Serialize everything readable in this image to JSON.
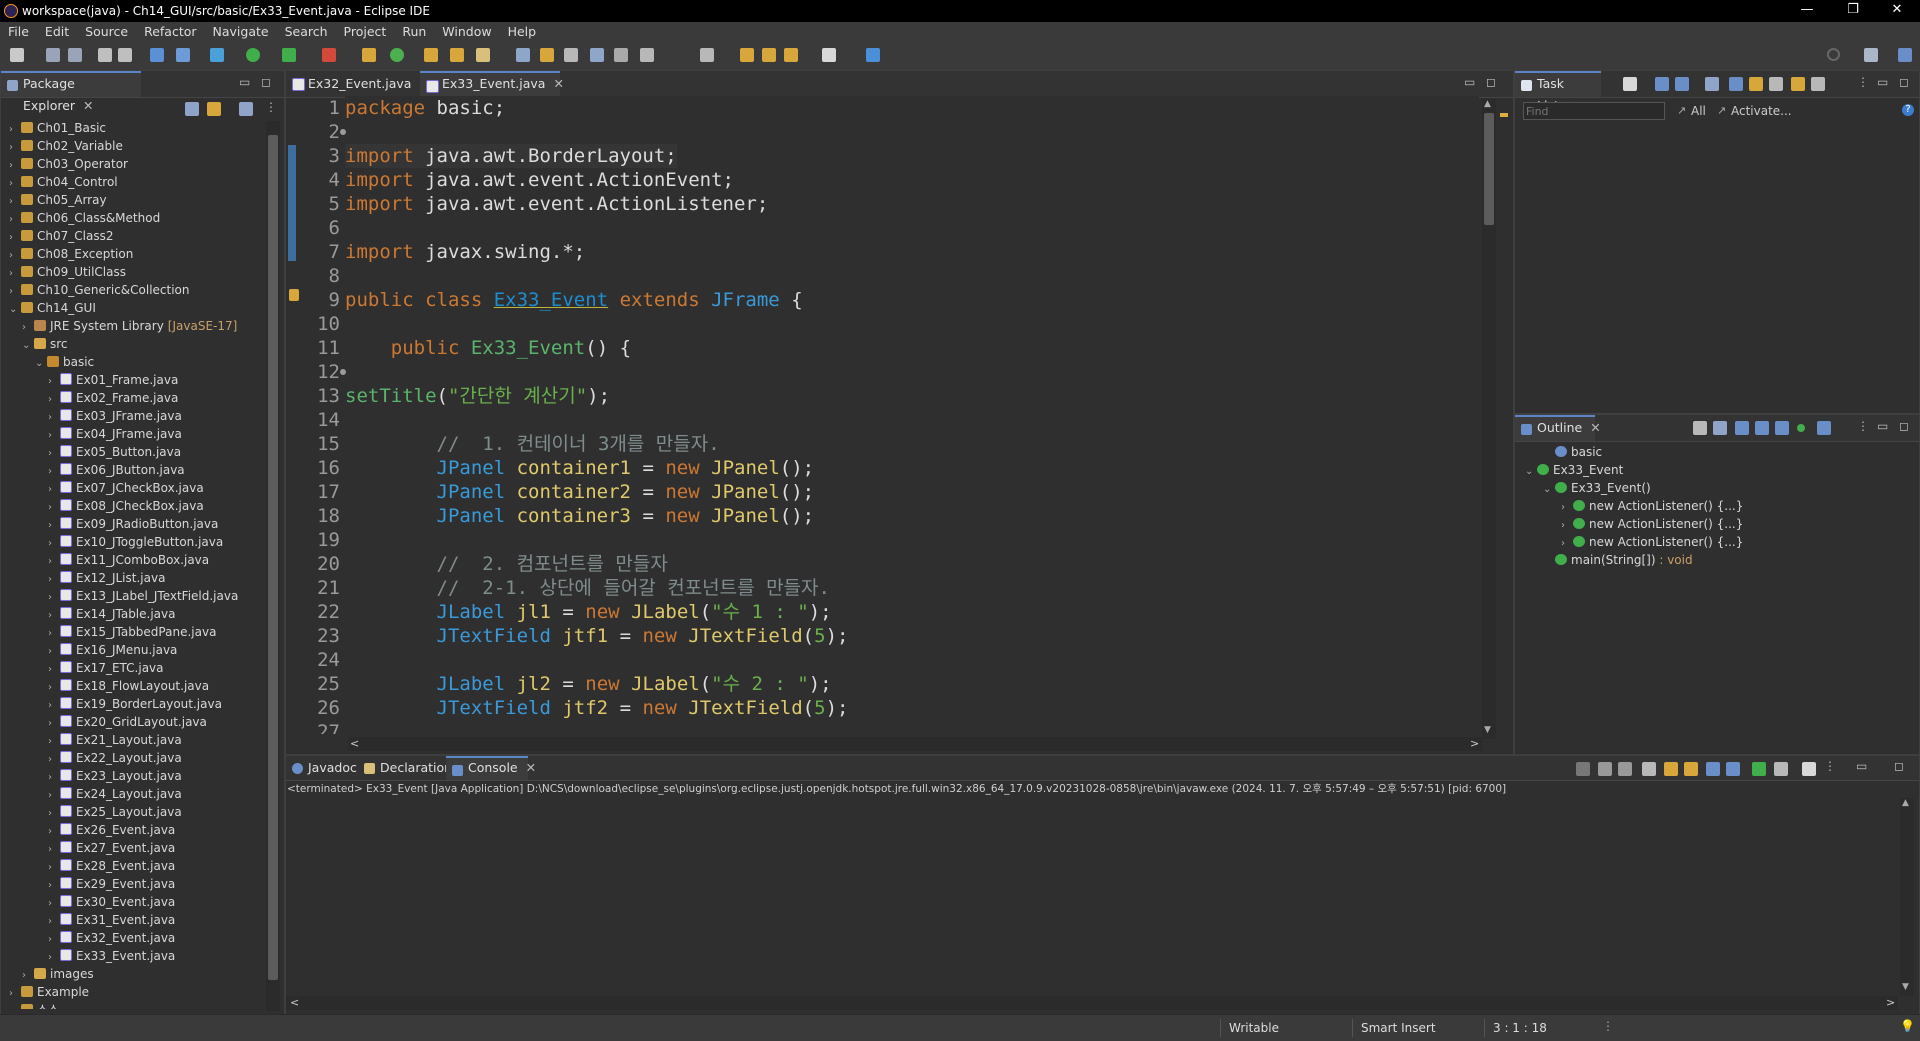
{
  "window": {
    "title": "workspace(java) - Ch14_GUI/src/basic/Ex33_Event.java - Eclipse IDE"
  },
  "menu": [
    "File",
    "Edit",
    "Source",
    "Refactor",
    "Navigate",
    "Search",
    "Project",
    "Run",
    "Window",
    "Help"
  ],
  "package_explorer": {
    "tab": "Package Explorer",
    "projects_top": [
      "Ch01_Basic",
      "Ch02_Variable",
      "Ch03_Operator",
      "Ch04_Control",
      "Ch05_Array",
      "Ch06_Class&Method",
      "Ch07_Class2",
      "Ch08_Exception",
      "Ch09_UtilClass",
      "Ch10_Generic&Collection",
      "Ch14_GUI"
    ],
    "jre": "JRE System Library",
    "jre_version": "[JavaSE-17]",
    "src": "src",
    "package": "basic",
    "files": [
      "Ex01_Frame.java",
      "Ex02_Frame.java",
      "Ex03_JFrame.java",
      "Ex04_JFrame.java",
      "Ex05_Button.java",
      "Ex06_JButton.java",
      "Ex07_JCheckBox.java",
      "Ex08_JCheckBox.java",
      "Ex09_JRadioButton.java",
      "Ex10_JToggleButton.java",
      "Ex11_JComboBox.java",
      "Ex12_JList.java",
      "Ex13_JLabel_JTextField.java",
      "Ex14_JTable.java",
      "Ex15_JTabbedPane.java",
      "Ex16_JMenu.java",
      "Ex17_ETC.java",
      "Ex18_FlowLayout.java",
      "Ex19_BorderLayout.java",
      "Ex20_GridLayout.java",
      "Ex21_Layout.java",
      "Ex22_Layout.java",
      "Ex23_Layout.java",
      "Ex24_Layout.java",
      "Ex25_Layout.java",
      "Ex26_Event.java",
      "Ex27_Event.java",
      "Ex28_Event.java",
      "Ex29_Event.java",
      "Ex30_Event.java",
      "Ex31_Event.java",
      "Ex32_Event.java",
      "Ex33_Event.java"
    ],
    "images": "images",
    "projects_bottom": [
      "Example",
      "소스"
    ]
  },
  "editor": {
    "tabs": [
      "Ex32_Event.java",
      "Ex33_Event.java"
    ],
    "lines": [
      {
        "n": "1",
        "html": "<span class=\"kw\">package</span> <span class=\"pl\">basic;</span>"
      },
      {
        "n": "2",
        "html": ""
      },
      {
        "n": "3",
        "html": "<span class=\"kw\">import</span> <span class=\"pl\">java.awt.BorderLayout;</span>"
      },
      {
        "n": "4",
        "html": "<span class=\"kw\">import</span> <span class=\"pl\">java.awt.event.ActionEvent;</span>"
      },
      {
        "n": "5",
        "html": "<span class=\"kw\">import</span> <span class=\"pl\">java.awt.event.ActionListener;</span>"
      },
      {
        "n": "6",
        "html": ""
      },
      {
        "n": "7",
        "html": "<span class=\"kw\">import</span> <span class=\"pl\">javax.swing.*;</span>"
      },
      {
        "n": "8",
        "html": ""
      },
      {
        "n": "9",
        "html": "<span class=\"kw\">public class</span> <span class=\"cls\">Ex33_Event</span> <span class=\"kw\">extends</span> <span class=\"ty\">JFrame</span> <span class=\"pl\">{</span>"
      },
      {
        "n": "10",
        "html": ""
      },
      {
        "n": "11",
        "html": "    <span class=\"kw\">public</span> <span class=\"fn\">Ex33_Event</span><span class=\"pl\">() {</span>"
      },
      {
        "n": "12",
        "html": ""
      },
      {
        "n": "13",
        "html": "<span class=\"fn\">setTitle</span><span class=\"pl\">(</span><span class=\"str\">\"간단한 계산기\"</span><span class=\"pl\">);</span>"
      },
      {
        "n": "14",
        "html": ""
      },
      {
        "n": "15",
        "html": "        <span class=\"cm\">//  1. 컨테이너 3개를 만들자.</span>"
      },
      {
        "n": "16",
        "html": "        <span class=\"ty\">JPanel</span> <span class=\"id\">container1</span> <span class=\"pl\">=</span> <span class=\"kw\">new</span> <span class=\"id\">JPanel</span><span class=\"pl\">();</span>"
      },
      {
        "n": "17",
        "html": "        <span class=\"ty\">JPanel</span> <span class=\"id\">container2</span> <span class=\"pl\">=</span> <span class=\"kw\">new</span> <span class=\"id\">JPanel</span><span class=\"pl\">();</span>"
      },
      {
        "n": "18",
        "html": "        <span class=\"ty\">JPanel</span> <span class=\"id\">container3</span> <span class=\"pl\">=</span> <span class=\"kw\">new</span> <span class=\"id\">JPanel</span><span class=\"pl\">();</span>"
      },
      {
        "n": "19",
        "html": ""
      },
      {
        "n": "20",
        "html": "        <span class=\"cm\">//  2. 컴포넌트를 만들자</span>"
      },
      {
        "n": "21",
        "html": "        <span class=\"cm\">//  2-1. 상단에 들어갈 컨포넌트를 만들자.</span>"
      },
      {
        "n": "22",
        "html": "        <span class=\"ty\">JLabel</span> <span class=\"id\">jl1</span> <span class=\"pl\">=</span> <span class=\"kw\">new</span> <span class=\"id\">JLabel</span><span class=\"pl\">(</span><span class=\"str\">\"수 1 : \"</span><span class=\"pl\">);</span>"
      },
      {
        "n": "23",
        "html": "        <span class=\"ty\">JTextField</span> <span class=\"id\">jtf1</span> <span class=\"pl\">=</span> <span class=\"kw\">new</span> <span class=\"id\">JTextField</span><span class=\"pl\">(</span><span class=\"str\">5</span><span class=\"pl\">);</span>"
      },
      {
        "n": "24",
        "html": ""
      },
      {
        "n": "25",
        "html": "        <span class=\"ty\">JLabel</span> <span class=\"id\">jl2</span> <span class=\"pl\">=</span> <span class=\"kw\">new</span> <span class=\"id\">JLabel</span><span class=\"pl\">(</span><span class=\"str\">\"수 2 : \"</span><span class=\"pl\">);</span>"
      },
      {
        "n": "26",
        "html": "        <span class=\"ty\">JTextField</span> <span class=\"id\">jtf2</span> <span class=\"pl\">=</span> <span class=\"kw\">new</span> <span class=\"id\">JTextField</span><span class=\"pl\">(</span><span class=\"str\">5</span><span class=\"pl\">);</span>"
      },
      {
        "n": "27",
        "html": ""
      }
    ]
  },
  "task_list": {
    "tab": "Task List",
    "find_placeholder": "Find",
    "all": "All",
    "activate": "Activate..."
  },
  "outline": {
    "tab": "Outline",
    "items": [
      "basic",
      "Ex33_Event",
      "Ex33_Event()",
      "new ActionListener() {...}",
      "new ActionListener() {...}",
      "new ActionListener() {...}",
      "main(String[])"
    ],
    "main_return": " : void"
  },
  "bottom": {
    "tabs": [
      "Javadoc",
      "Declaration",
      "Console"
    ],
    "console_status": "<terminated> Ex33_Event [Java Application] D:\\NCS\\download\\eclipse_se\\plugins\\org.eclipse.justj.openjdk.hotspot.jre.full.win32.x86_64_17.0.9.v20231028-0858\\jre\\bin\\javaw.exe  (2024. 11. 7. 오후 5:57:49 – 오후 5:57:51) [pid: 6700]"
  },
  "status_bar": {
    "writable": "Writable",
    "insert_mode": "Smart Insert",
    "position": "3 : 1 : 18"
  },
  "colors": {
    "accent": "#5a86c8",
    "background": "#2f2f2f",
    "keyword": "#cc7832",
    "string": "#6ab04c"
  }
}
